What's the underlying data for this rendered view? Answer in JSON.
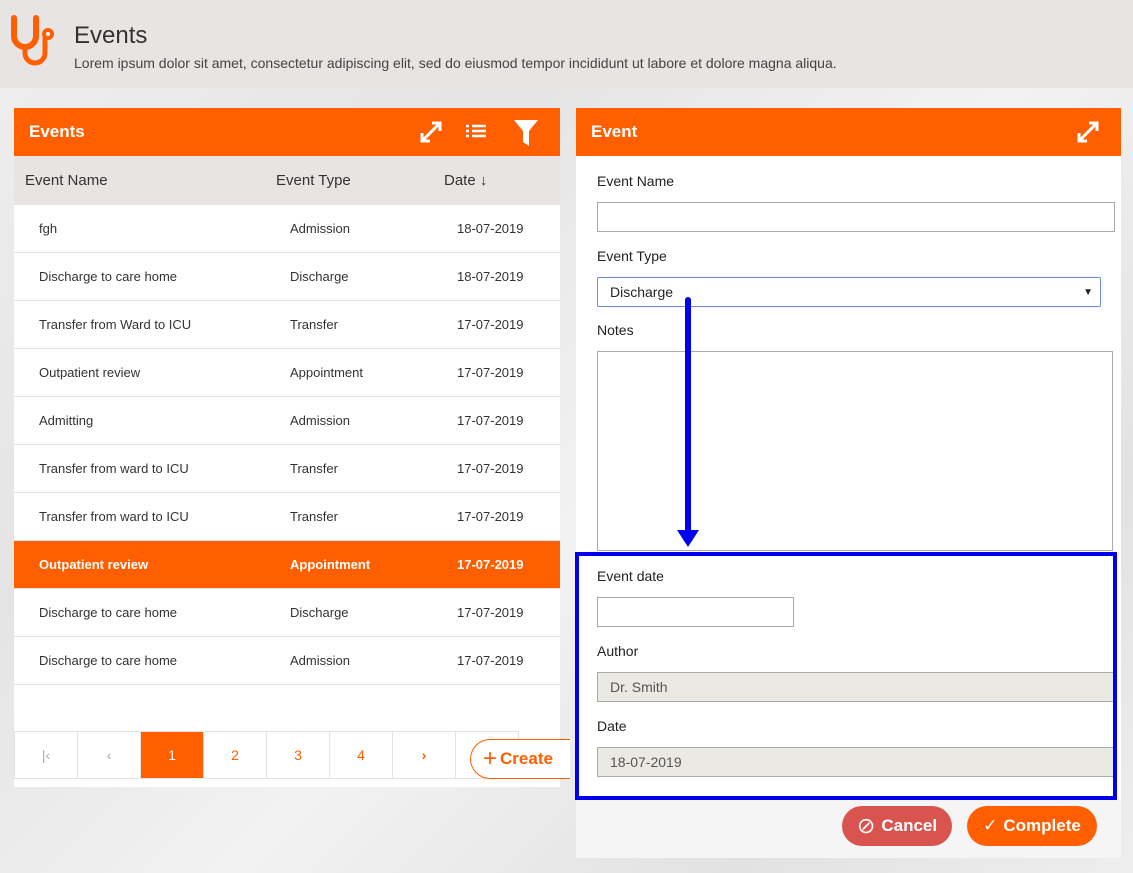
{
  "header": {
    "title": "Events",
    "subtitle": "Lorem ipsum dolor sit amet, consectetur adipiscing elit, sed do eiusmod tempor incididunt ut labore et dolore magna aliqua.",
    "logo_icon": "stethoscope-icon"
  },
  "colors": {
    "accent": "#ff5f00",
    "cancel": "#d9534f",
    "annotation": "#0000ee"
  },
  "events_panel": {
    "title": "Events",
    "icons": [
      "expand-icon",
      "list-icon",
      "filter-icon"
    ],
    "columns": [
      "Event Name",
      "Event Type",
      "Date ↓"
    ],
    "rows": [
      {
        "name": "fgh",
        "type": "Admission",
        "date": "18-07-2019"
      },
      {
        "name": "Discharge to care home",
        "type": "Discharge",
        "date": "18-07-2019"
      },
      {
        "name": "Transfer from Ward to ICU",
        "type": "Transfer",
        "date": "17-07-2019"
      },
      {
        "name": "Outpatient review",
        "type": "Appointment",
        "date": "17-07-2019"
      },
      {
        "name": "Admitting",
        "type": "Admission",
        "date": "17-07-2019"
      },
      {
        "name": "Transfer from ward to ICU",
        "type": "Transfer",
        "date": "17-07-2019"
      },
      {
        "name": "Transfer from ward to ICU",
        "type": "Transfer",
        "date": "17-07-2019"
      },
      {
        "name": "Outpatient review",
        "type": "Appointment",
        "date": "17-07-2019",
        "selected": true
      },
      {
        "name": "Discharge to care home",
        "type": "Discharge",
        "date": "17-07-2019"
      },
      {
        "name": "Discharge to care home",
        "type": "Admission",
        "date": "17-07-2019"
      }
    ],
    "pages": [
      "1",
      "2",
      "3",
      "4"
    ],
    "current_page": "1",
    "create_label": "Create"
  },
  "event_panel": {
    "title": "Event",
    "event_name_label": "Event Name",
    "event_name_value": "",
    "event_type_label": "Event Type",
    "event_type_value": "Discharge",
    "notes_label": "Notes",
    "notes_value": "",
    "event_date_label": "Event date",
    "event_date_value": "",
    "author_label": "Author",
    "author_value": "Dr. Smith",
    "date_label": "Date",
    "date_value": "18-07-2019",
    "cancel_label": "Cancel",
    "complete_label": "Complete"
  }
}
